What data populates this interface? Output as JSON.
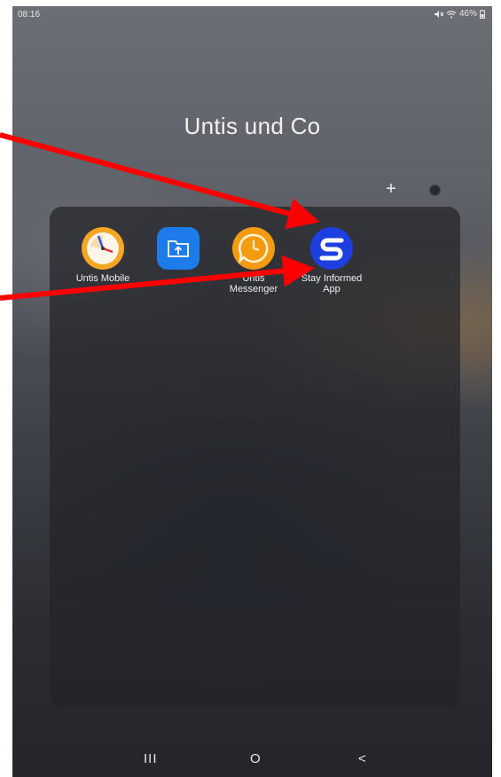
{
  "status_bar": {
    "time": "08:16",
    "battery": "46%",
    "icons": [
      "mute-icon",
      "wifi-icon",
      "battery-icon"
    ]
  },
  "folder": {
    "title": "Untis und Co",
    "add_icon": "+",
    "apps": [
      {
        "name": "untis-mobile",
        "label_line1": "Untis Mobile",
        "label_line2": "",
        "icon": "clock-icon",
        "color": "#f5a623"
      },
      {
        "name": "files",
        "label_line1": "",
        "label_line2": "",
        "icon": "folder-upload-icon",
        "color": "#1e7bea"
      },
      {
        "name": "untis-messenger",
        "label_line1": "Untis",
        "label_line2": "Messenger",
        "icon": "chat-clock-icon",
        "color": "#f39c12"
      },
      {
        "name": "stay-informed",
        "label_line1": "Stay Informed",
        "label_line2": "App",
        "icon": "s-logo-icon",
        "color": "#1e3fe0"
      }
    ]
  },
  "navigation": {
    "recents": "III",
    "home": "O",
    "back": "<"
  },
  "colors": {
    "annotation_arrow": "#ff0000"
  }
}
